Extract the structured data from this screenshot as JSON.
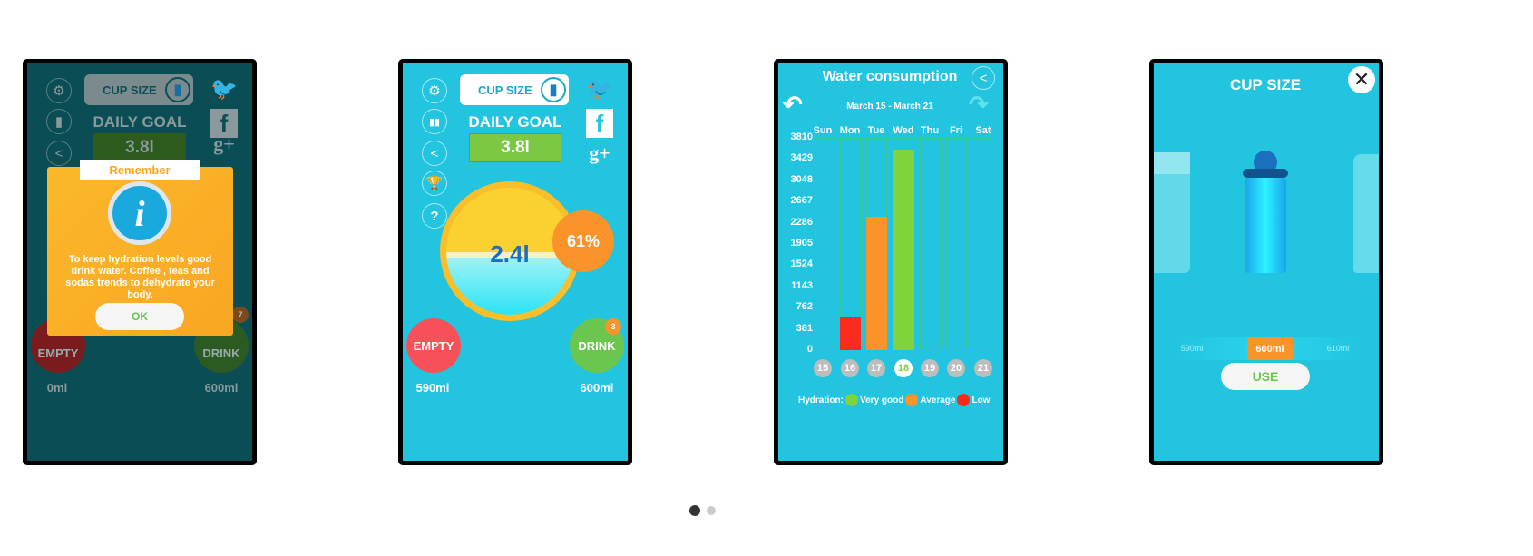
{
  "colors": {
    "screen": "#22c4e0",
    "very_good": "#7ed43a",
    "average": "#f9932a",
    "low": "#fb2b1d",
    "empty_btn": "#f65158",
    "drink_btn": "#6ac64e"
  },
  "screen1": {
    "cup_size": "CUP SIZE",
    "daily_goal": "DAILY GOAL",
    "goal_value": "3.8l",
    "empty_label": "EMPTY",
    "empty_amount": "0ml",
    "drink_label": "DRINK",
    "drink_amount": "600ml",
    "drink_badge": "7",
    "dialog": {
      "title": "Remember",
      "message": "To keep hydration levels good drink water. Coffee , teas and sodas trends to dehydrate your body.",
      "ok": "OK",
      "icon": "info-icon"
    }
  },
  "screen2": {
    "cup_size": "CUP SIZE",
    "daily_goal": "DAILY GOAL",
    "goal_value": "3.8l",
    "current": "2.4l",
    "percent": "61%",
    "progress_percent": 61,
    "empty_label": "EMPTY",
    "empty_amount": "590ml",
    "drink_label": "DRINK",
    "drink_amount": "600ml",
    "drink_badge": "3",
    "side_icons": [
      "gear-icon",
      "stats-icon",
      "share-icon",
      "trophy-icon",
      "help-icon"
    ],
    "social": [
      "twitter-icon",
      "facebook-icon",
      "google-plus-icon"
    ]
  },
  "screen3": {
    "title": "Water consumption",
    "date_range": "March 15 - March 21",
    "legend_label": "Hydration:",
    "legend": [
      {
        "label": "Very good",
        "color": "#7ed43a"
      },
      {
        "label": "Average",
        "color": "#f9932a"
      },
      {
        "label": "Low",
        "color": "#fb2b1d"
      }
    ],
    "chart_data": {
      "type": "bar",
      "title": "Water consumption",
      "categories": [
        "Sun",
        "Mon",
        "Tue",
        "Wed",
        "Thu",
        "Fri",
        "Sat"
      ],
      "dates": [
        "15",
        "16",
        "17",
        "18",
        "19",
        "20",
        "21"
      ],
      "selected_date": "18",
      "values": [
        0,
        590,
        2400,
        3600,
        0,
        0,
        0
      ],
      "bar_colors": [
        "#7ed43a",
        "#fb2b1d",
        "#f9932a",
        "#7ed43a",
        "#7ed43a",
        "#7ed43a",
        "#7ed43a"
      ],
      "yticks": [
        "3810",
        "3429",
        "3048",
        "2667",
        "2286",
        "1905",
        "1524",
        "1143",
        "762",
        "381",
        "0"
      ],
      "ylim": [
        0,
        3810
      ]
    }
  },
  "screen4": {
    "title": "CUP SIZE",
    "sizes": [
      "590ml",
      "600ml",
      "610ml"
    ],
    "selected": "600ml",
    "use": "USE"
  },
  "pager": {
    "pages": 2,
    "active": 1
  }
}
